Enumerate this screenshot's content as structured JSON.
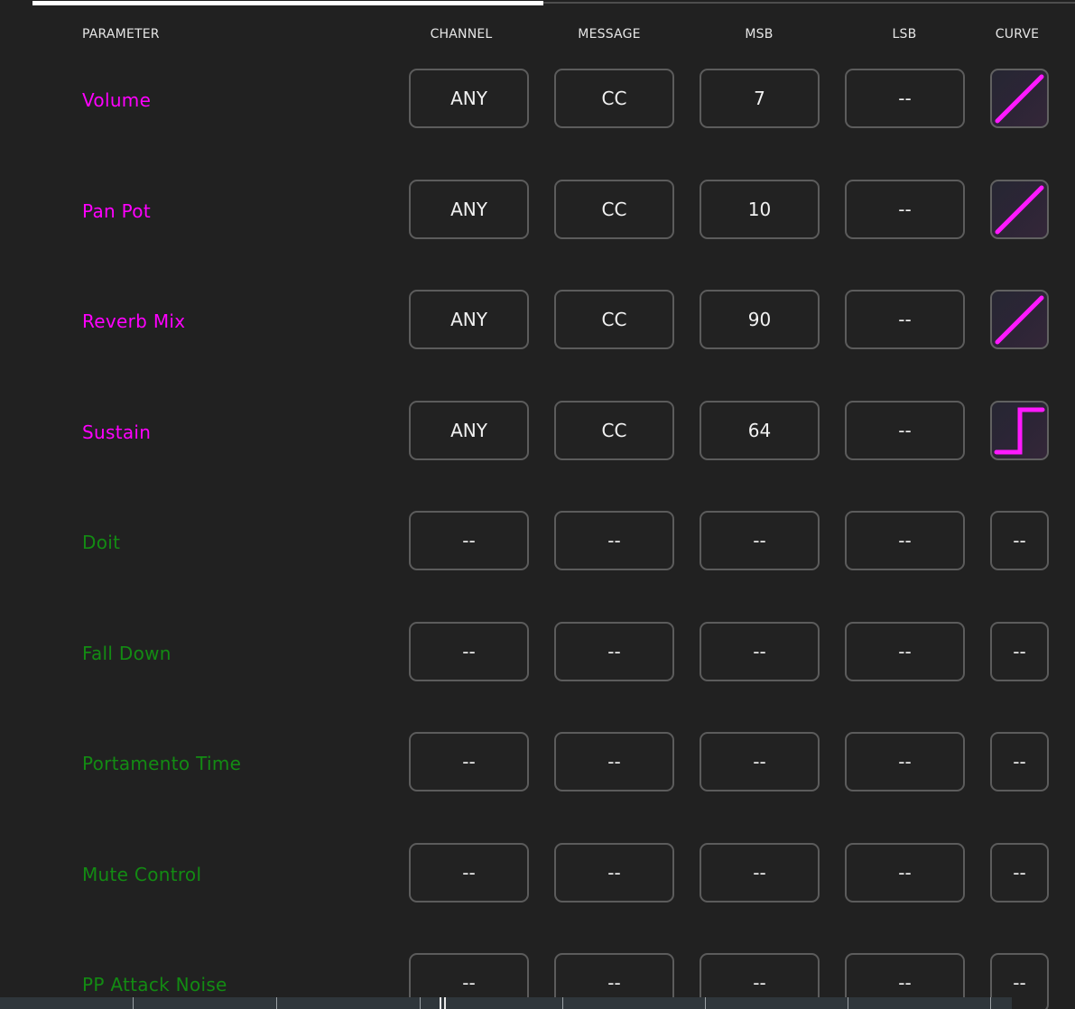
{
  "progress": {
    "fraction": 0.49
  },
  "header": {
    "parameter": "PARAMETER",
    "channel": "CHANNEL",
    "message": "MESSAGE",
    "msb": "MSB",
    "lsb": "LSB",
    "curve": "CURVE"
  },
  "colors": {
    "assigned": "#ff00ff",
    "unassigned": "#138b13",
    "curve_stroke": "#ff19ff"
  },
  "rows": [
    {
      "parameter": "Volume",
      "assigned": true,
      "channel": "ANY",
      "message": "CC",
      "msb": "7",
      "lsb": "--",
      "curve": "linear-icon",
      "curve_text": ""
    },
    {
      "parameter": "Pan Pot",
      "assigned": true,
      "channel": "ANY",
      "message": "CC",
      "msb": "10",
      "lsb": "--",
      "curve": "linear-icon",
      "curve_text": ""
    },
    {
      "parameter": "Reverb Mix",
      "assigned": true,
      "channel": "ANY",
      "message": "CC",
      "msb": "90",
      "lsb": "--",
      "curve": "linear-icon",
      "curve_text": ""
    },
    {
      "parameter": "Sustain",
      "assigned": true,
      "channel": "ANY",
      "message": "CC",
      "msb": "64",
      "lsb": "--",
      "curve": "step-icon",
      "curve_text": ""
    },
    {
      "parameter": "Doit",
      "assigned": false,
      "channel": "--",
      "message": "--",
      "msb": "--",
      "lsb": "--",
      "curve": "none",
      "curve_text": "--"
    },
    {
      "parameter": "Fall Down",
      "assigned": false,
      "channel": "--",
      "message": "--",
      "msb": "--",
      "lsb": "--",
      "curve": "none",
      "curve_text": "--"
    },
    {
      "parameter": "Portamento Time",
      "assigned": false,
      "channel": "--",
      "message": "--",
      "msb": "--",
      "lsb": "--",
      "curve": "none",
      "curve_text": "--"
    },
    {
      "parameter": "Mute Control",
      "assigned": false,
      "channel": "--",
      "message": "--",
      "msb": "--",
      "lsb": "--",
      "curve": "none",
      "curve_text": "--"
    },
    {
      "parameter": "PP Attack Noise",
      "assigned": false,
      "channel": "--",
      "message": "--",
      "msb": "--",
      "lsb": "--",
      "curve": "none",
      "curve_text": "--"
    }
  ]
}
